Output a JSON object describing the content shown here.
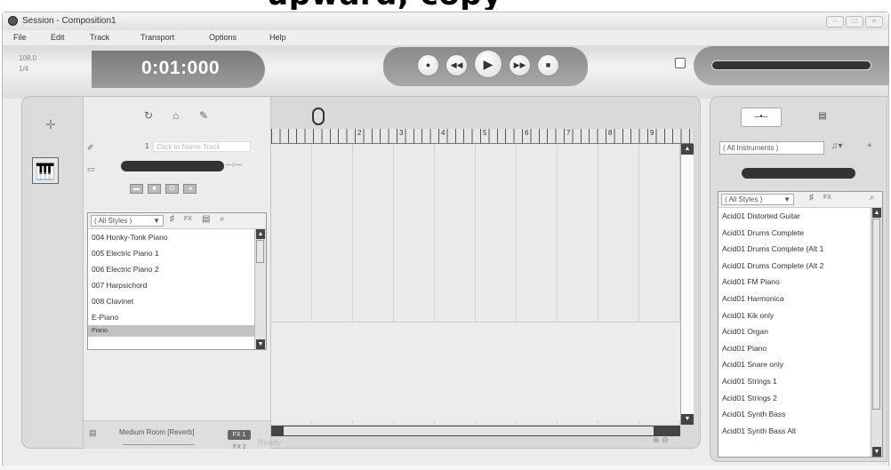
{
  "banner_text": "upward, copy",
  "window": {
    "title": "Session - Composition1",
    "controls": [
      "–",
      "□",
      "×"
    ]
  },
  "menu": [
    "File",
    "Edit",
    "Track",
    "Transport",
    "Options",
    "Help"
  ],
  "transport": {
    "tempo": "108.0",
    "signature": "1/4",
    "time": "0:01:000",
    "buttons": [
      "record",
      "rewind",
      "play",
      "fast-forward",
      "stop"
    ]
  },
  "track": {
    "number": "1",
    "name_placeholder": "Click to Name Track",
    "fx_name": "Medium Room [Reverb]",
    "fx1_label": "FX 1",
    "fx2_label": "FX 2"
  },
  "instrument_list": {
    "filter": "( All Styles )",
    "items": [
      "004 Honky-Tonk Piano",
      "005 Electric Piano 1",
      "006 Electric Piano 2",
      "007 Harpsichord",
      "008 Clavinet",
      "E-Piano"
    ],
    "selected": "Piano"
  },
  "ruler": {
    "marks": [
      "2",
      "3",
      "4",
      "5",
      "6",
      "7",
      "8",
      "9"
    ]
  },
  "status": {
    "text": "Ready"
  },
  "right_panel": {
    "instrument_filter": "( All Instruments )",
    "style_filter": "( All Styles )",
    "fx_label": "FX",
    "items": [
      "Acid01 Distorted Guitar",
      "Acid01 Drums Complete",
      "Acid01 Drums Complete (Alt 1",
      "Acid01 Drums Complete (Alt 2",
      "Acid01 FM Piano",
      "Acid01 Harmonica",
      "Acid01 Kik only",
      "Acid01 Organ",
      "Acid01 Piano",
      "Acid01 Snare only",
      "Acid01 Strings 1",
      "Acid01 Strings 2",
      "Acid01 Synth Bass",
      "Acid01 Synth Bass Alt"
    ]
  }
}
